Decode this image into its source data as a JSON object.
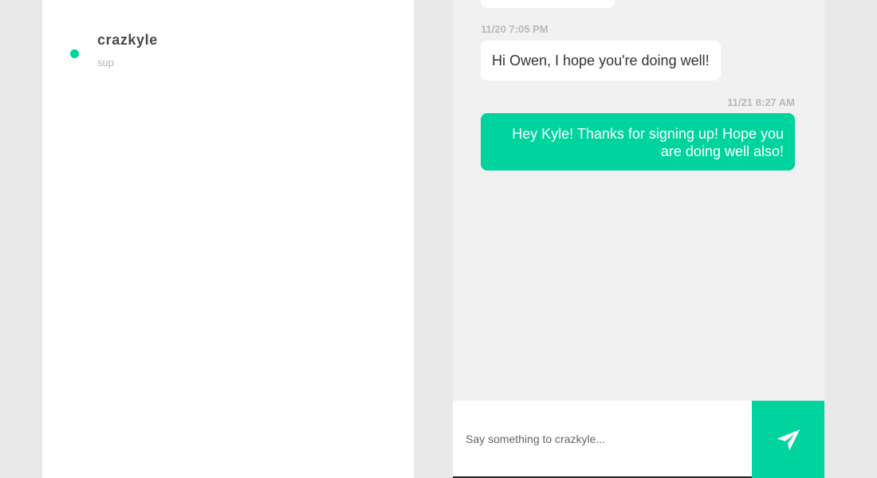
{
  "contacts": [
    {
      "name": "crazkyle",
      "preview": "sup",
      "status": "online"
    }
  ],
  "conversation": {
    "messages": [
      {
        "direction": "received",
        "timestamp": "11/20 7:05 PM",
        "text": "Hi Owen, I hope you're doing well!"
      },
      {
        "direction": "sent",
        "timestamp": "11/21 8:27 AM",
        "text": "Hey Kyle! Thanks for signing up! Hope you are doing well also!"
      }
    ]
  },
  "composer": {
    "value": "",
    "placeholder": "Say something to crazkyle...",
    "send_icon": "paper-plane-icon"
  },
  "colors": {
    "accent": "#00d49e",
    "page_background": "#e9e9e9",
    "chat_background": "#f1f1f1",
    "panel_background": "#ffffff",
    "timestamp": "#b9b9b9",
    "preview_text": "#b5b5b5"
  }
}
